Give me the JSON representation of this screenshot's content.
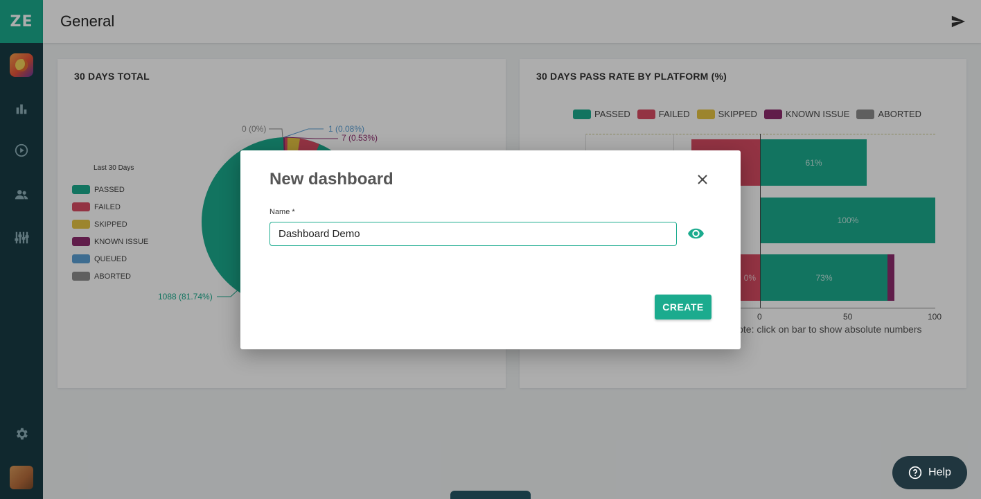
{
  "app": {
    "logo_text": "ZE"
  },
  "header": {
    "title": "General"
  },
  "sidebar": {
    "items": [
      {
        "name": "project-avatar"
      },
      {
        "name": "dashboards",
        "icon": "bar-chart-icon"
      },
      {
        "name": "runs",
        "icon": "play-circle-icon"
      },
      {
        "name": "users",
        "icon": "people-icon"
      },
      {
        "name": "integrations",
        "icon": "sliders-icon"
      },
      {
        "name": "settings",
        "icon": "gear-icon"
      }
    ]
  },
  "widgets": {
    "total": {
      "title": "30 DAYS TOTAL",
      "legend_title": "Last 30 Days",
      "legend": [
        "PASSED",
        "FAILED",
        "SKIPPED",
        "KNOWN ISSUE",
        "QUEUED",
        "ABORTED"
      ],
      "labels": {
        "aborted": "0 (0%)",
        "queued": "1 (0.08%)",
        "known_issue": "7 (0.53%)",
        "passed": "1088 (81.74%)"
      }
    },
    "pass_rate": {
      "title": "30 DAYS PASS RATE BY PLATFORM (%)",
      "legend": [
        "PASSED",
        "FAILED",
        "SKIPPED",
        "KNOWN ISSUE",
        "ABORTED"
      ],
      "bars": [
        {
          "passed_label": "61%"
        },
        {
          "passed_label": "100%"
        },
        {
          "passed_label": "73%",
          "failed_label": "0%"
        }
      ],
      "ticks": [
        "0",
        "50",
        "100"
      ],
      "note": "Note: click on bar to show absolute numbers"
    }
  },
  "chart_data": [
    {
      "type": "pie",
      "title": "30 DAYS TOTAL",
      "labels": [
        "PASSED",
        "QUEUED",
        "KNOWN ISSUE",
        "ABORTED"
      ],
      "values": [
        1088,
        1,
        7,
        0
      ],
      "percentages": [
        81.74,
        0.08,
        0.53,
        0
      ]
    },
    {
      "type": "bar",
      "title": "30 DAYS PASS RATE BY PLATFORM (%)",
      "series": [
        {
          "name": "PASSED",
          "values": [
            61,
            100,
            73
          ]
        },
        {
          "name": "FAILED",
          "values": [
            null,
            null,
            0
          ]
        }
      ],
      "xlim": [
        0,
        100
      ]
    }
  ],
  "colors": {
    "passed": "#1bab8e",
    "failed": "#d94c63",
    "skipped": "#e6c443",
    "known_issue": "#8e2c6d",
    "queued": "#5a9fd4",
    "aborted": "#8c8c8c",
    "accent": "#1bab8e"
  },
  "modal": {
    "title": "New dashboard",
    "name_label": "Name *",
    "name_value": "Dashboard Demo",
    "create_label": "CREATE",
    "visibility_icon": "eye-icon",
    "close_icon": "close-icon"
  },
  "help": {
    "label": "Help"
  }
}
